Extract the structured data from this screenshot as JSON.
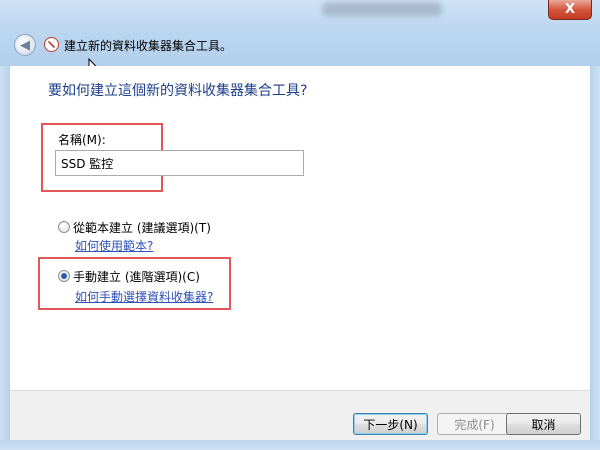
{
  "window": {
    "close_symbol": "X"
  },
  "header": {
    "title": "建立新的資料收集器集合工具。"
  },
  "main": {
    "question": "要如何建立這個新的資料收集器集合工具?",
    "name": {
      "label": "名稱(M):",
      "value": "SSD 監控"
    },
    "options": [
      {
        "label": "從範本建立 (建議選項)(T)",
        "link": "如何使用範本?",
        "selected": false
      },
      {
        "label": "手動建立 (進階選項)(C)",
        "link": "如何手動選擇資料收集器?",
        "selected": true
      }
    ]
  },
  "footer": {
    "next_label": "下一步(N)",
    "finish_label": "完成(F)",
    "cancel_label": "取消"
  },
  "colors": {
    "heading": "#1e3f8e",
    "link": "#2f52b8",
    "highlight": "#e15757"
  },
  "icons": {
    "back": "back-arrow-icon",
    "app": "data-collector-icon",
    "close": "close-icon"
  }
}
